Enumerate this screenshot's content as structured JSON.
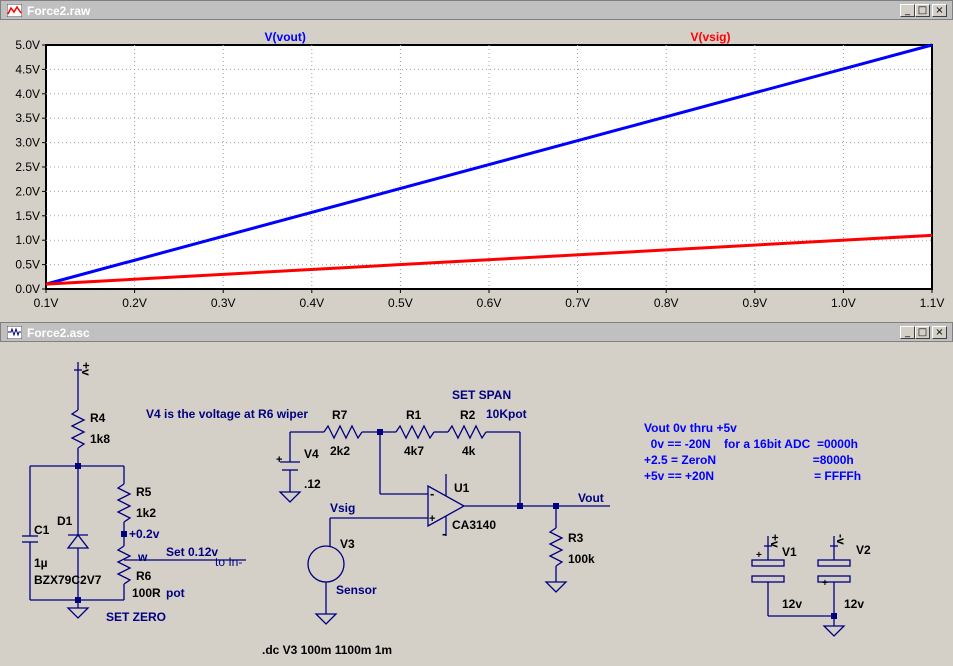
{
  "waveform_window": {
    "title": "Force2.raw",
    "title_bg": "#c0c0c0",
    "title_color": "#ffffff",
    "buttons": {
      "minimize": "_",
      "maximize": "□",
      "close": "×"
    }
  },
  "schematic_window": {
    "title": "Force2.asc",
    "title_bg": "#c0c0c0",
    "title_color": "#ffffff",
    "buttons": {
      "minimize": "_",
      "maximize": "□",
      "close": "×"
    }
  },
  "chart_data": {
    "type": "line",
    "x": [
      0.1,
      1.1
    ],
    "series": [
      {
        "name": "V(vout)",
        "color": "#0000ff",
        "values": [
          0.1,
          5.0
        ]
      },
      {
        "name": "V(vsig)",
        "color": "#ff0000",
        "values": [
          0.1,
          1.1
        ]
      }
    ],
    "xticks": [
      "0.1V",
      "0.2V",
      "0.3V",
      "0.4V",
      "0.5V",
      "0.6V",
      "0.7V",
      "0.8V",
      "0.9V",
      "1.0V",
      "1.1V"
    ],
    "yticks": [
      "0.0V",
      "0.5V",
      "1.0V",
      "1.5V",
      "2.0V",
      "2.5V",
      "3.0V",
      "3.5V",
      "4.0V",
      "4.5V",
      "5.0V"
    ],
    "xlim": [
      0.1,
      1.1
    ],
    "ylim": [
      0.0,
      5.0
    ],
    "grid": true,
    "legend": "top"
  },
  "schematic": {
    "wire_color": "#000080",
    "label_color": "#000080",
    "note_color": "#0000ff",
    "components": {
      "R4": {
        "name": "R4",
        "value": "1k8"
      },
      "R5": {
        "name": "R5",
        "value": "1k2"
      },
      "R6": {
        "name": "R6",
        "value": "100R"
      },
      "R7": {
        "name": "R7",
        "value": "2k2"
      },
      "R1": {
        "name": "R1",
        "value": "4k7"
      },
      "R2": {
        "name": "R2",
        "value": "4k"
      },
      "R3": {
        "name": "R3",
        "value": "100k"
      },
      "C1": {
        "name": "C1",
        "value": "1µ"
      },
      "D1": {
        "name": "D1",
        "value": "BZX79C2V7"
      },
      "V4": {
        "name": "V4",
        "value": ".12"
      },
      "V3": {
        "name": "V3",
        "value": "Sensor"
      },
      "U1": {
        "name": "U1",
        "value": "CA3140"
      },
      "V1": {
        "name": "V1",
        "value": "12v"
      },
      "V2": {
        "name": "V2",
        "value": "12v"
      }
    },
    "labels": {
      "plus_v": "+v",
      "minus_v": "-v",
      "pot": "pot",
      "wiper": "w",
      "node_0_2v": "+0.2v",
      "vsig": "Vsig",
      "vout": "Vout",
      "set_zero": "SET ZERO",
      "set_span": "SET SPAN",
      "pot_10k": "10Kpot",
      "set_012": "Set 0.12v",
      "to_in_minus": "to In-",
      "v4_note": "V4 is the voltage at R6 wiper",
      "dc_directive": ".dc V3 100m 1100m 1m",
      "opamp_plus": "+",
      "opamp_minus": "-",
      "vs_plus": "+"
    },
    "notes": [
      "Vout 0v thru +5v",
      "  0v == -20N    for a 16bit ADC  =0000h",
      "+2.5 = ZeroN                             =8000h",
      "+5v == +20N                              = FFFFh"
    ]
  }
}
